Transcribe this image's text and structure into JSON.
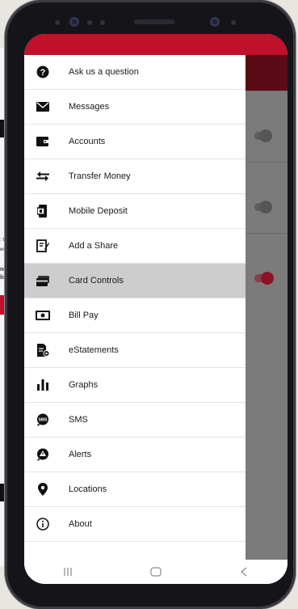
{
  "background": {
    "left_text_1": ": 800",
    "left_text_2": "er: 2",
    "left_text_3": "nd",
    "left_text_4": "list y"
  },
  "drawer": {
    "items": [
      {
        "label": "Ask us a question",
        "icon": "question-circle-icon"
      },
      {
        "label": "Messages",
        "icon": "envelope-icon"
      },
      {
        "label": "Accounts",
        "icon": "wallet-icon"
      },
      {
        "label": "Transfer Money",
        "icon": "transfer-arrows-icon"
      },
      {
        "label": "Mobile Deposit",
        "icon": "mobile-deposit-icon"
      },
      {
        "label": "Add a Share",
        "icon": "add-share-icon"
      },
      {
        "label": "Card Controls",
        "icon": "card-icon",
        "active": true
      },
      {
        "label": "Bill Pay",
        "icon": "bill-icon"
      },
      {
        "label": "eStatements",
        "icon": "estatement-icon"
      },
      {
        "label": "Graphs",
        "icon": "bar-graph-icon"
      },
      {
        "label": "SMS",
        "icon": "sms-bubble-icon"
      },
      {
        "label": "Alerts",
        "icon": "alert-icon"
      },
      {
        "label": "Locations",
        "icon": "location-pin-icon"
      },
      {
        "label": "About",
        "icon": "info-icon"
      }
    ]
  },
  "colors": {
    "brand_red": "#c0102a",
    "active_row": "#cdcdcd",
    "overlay": "#7b7b7b"
  },
  "behind_toggles": [
    {
      "state": "off"
    },
    {
      "state": "off"
    },
    {
      "state": "on"
    }
  ],
  "navbar": {
    "recent_icon": "recent-apps-icon",
    "home_icon": "home-icon",
    "back_icon": "back-icon"
  }
}
